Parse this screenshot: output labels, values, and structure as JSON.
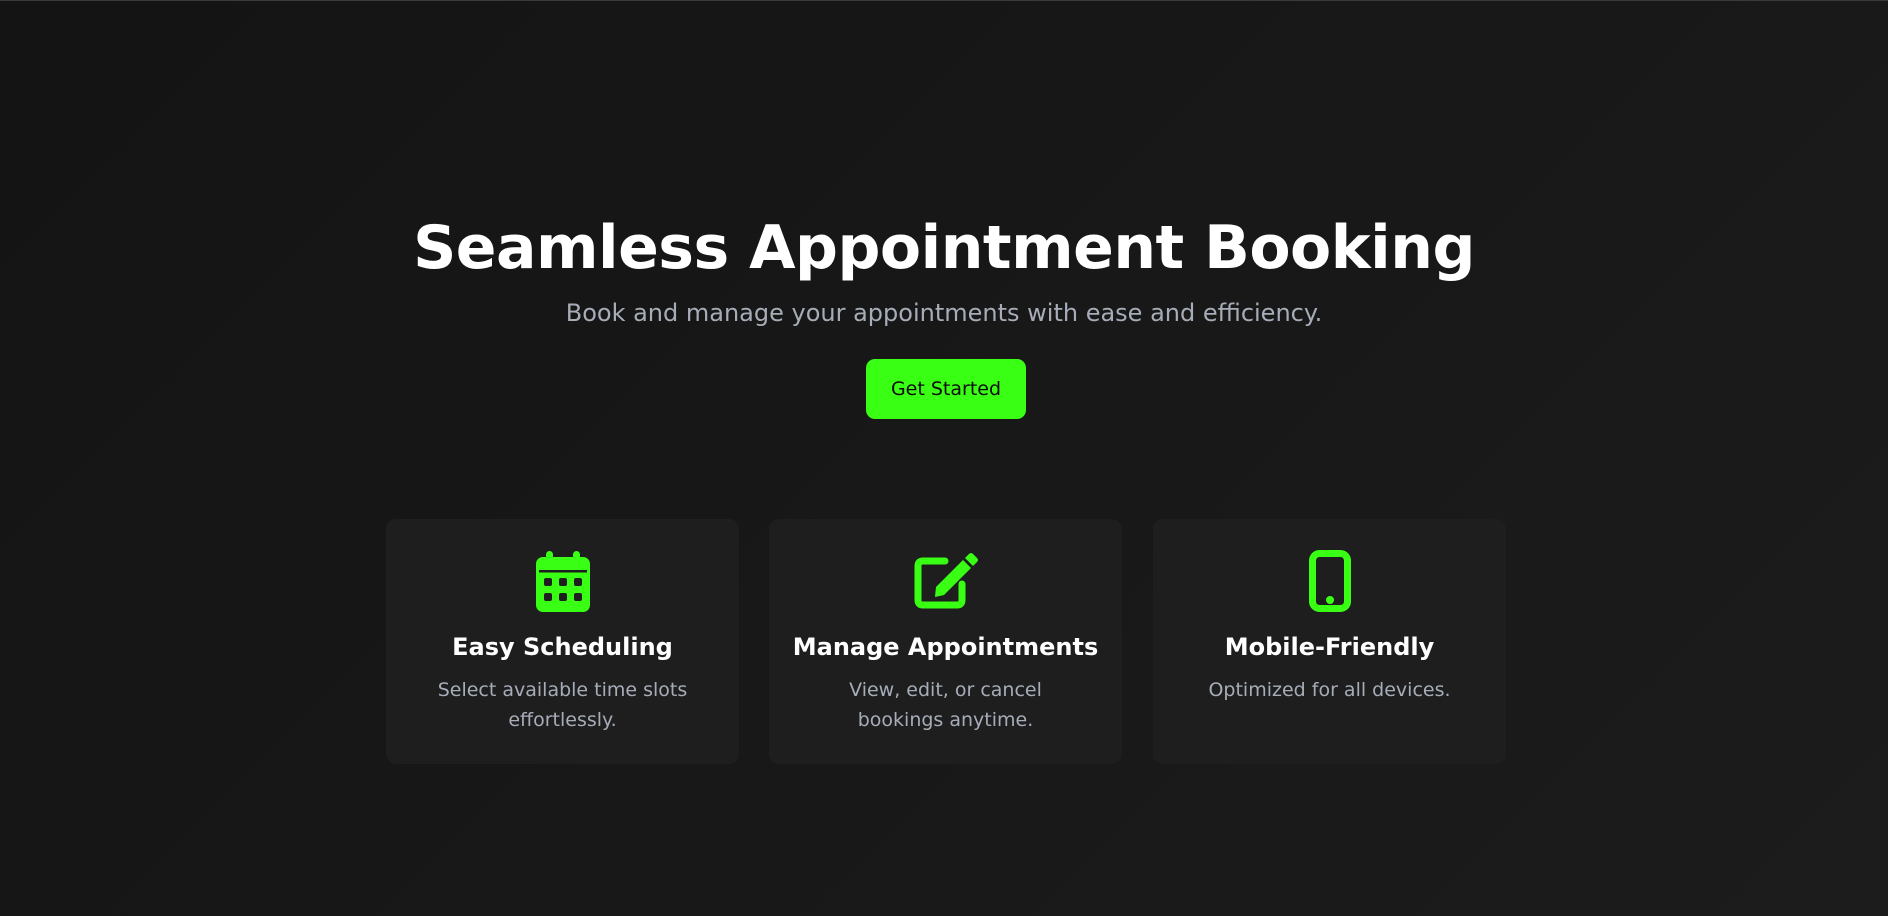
{
  "hero": {
    "title": "Seamless Appointment Booking",
    "subtitle": "Book and manage your appointments with ease and efficiency.",
    "cta_label": "Get Started"
  },
  "features": [
    {
      "icon": "calendar-icon",
      "title": "Easy Scheduling",
      "description": "Select available time slots effortlessly."
    },
    {
      "icon": "edit-icon",
      "title": "Manage Appointments",
      "description": "View, edit, or cancel bookings anytime."
    },
    {
      "icon": "mobile-phone-icon",
      "title": "Mobile-Friendly",
      "description": "Optimized for all devices."
    }
  ],
  "colors": {
    "accent": "#39ff14",
    "background": "#181818",
    "card": "#1e1e1e",
    "muted_text": "#a6adb8"
  }
}
